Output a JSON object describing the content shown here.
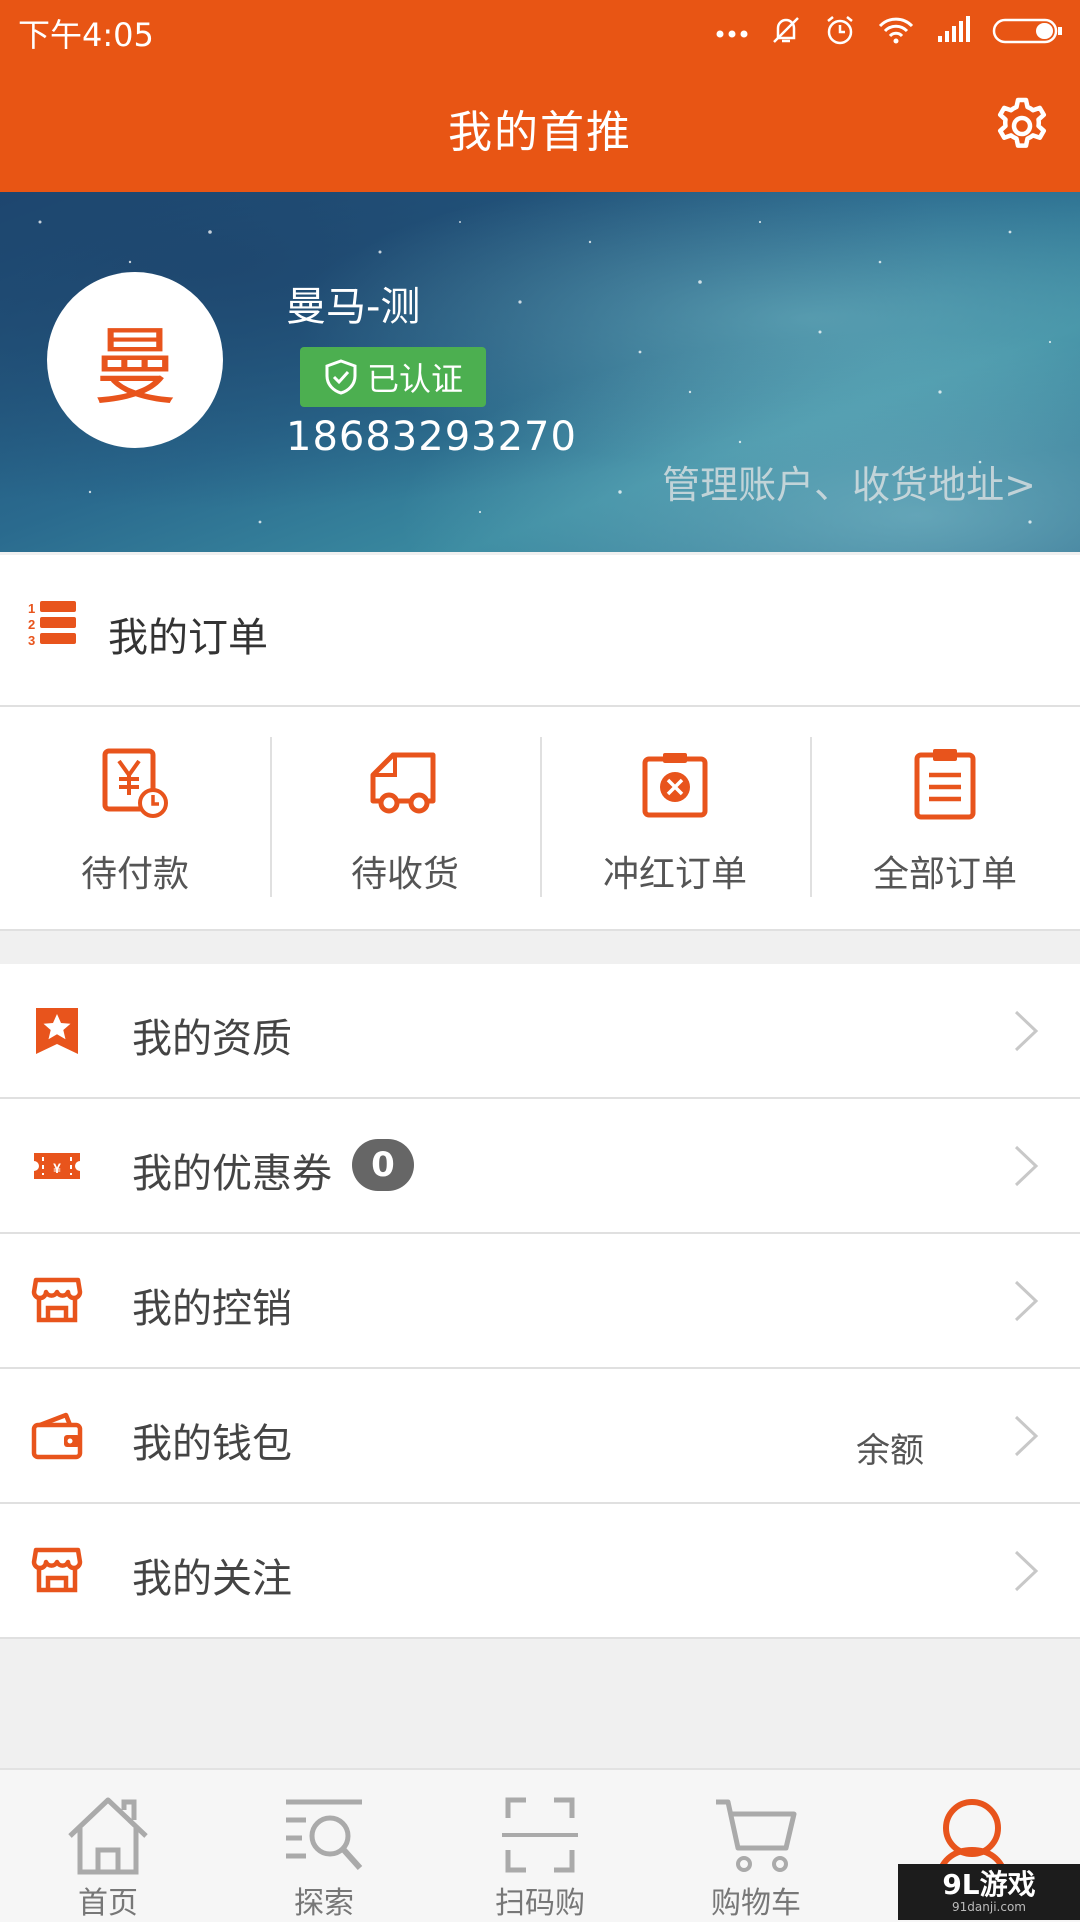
{
  "status_bar": {
    "time": "下午4:05"
  },
  "header": {
    "title": "我的首推"
  },
  "profile": {
    "avatar_char": "曼",
    "name": "曼马-测",
    "verified_label": "已认证",
    "phone": "18683293270",
    "manage_link": "管理账户、收货地址>"
  },
  "orders": {
    "title": "我的订单",
    "items": [
      {
        "label": "待付款",
        "icon": "payment-pending-icon"
      },
      {
        "label": "待收货",
        "icon": "delivery-truck-icon"
      },
      {
        "label": "冲红订单",
        "icon": "cancel-order-icon"
      },
      {
        "label": "全部订单",
        "icon": "clipboard-list-icon"
      }
    ]
  },
  "menu": {
    "items": [
      {
        "label": "我的资质",
        "icon": "star-bookmark-icon"
      },
      {
        "label": "我的优惠券",
        "icon": "coupon-icon",
        "badge": "0"
      },
      {
        "label": "我的控销",
        "icon": "store-icon"
      },
      {
        "label": "我的钱包",
        "icon": "wallet-icon",
        "extra": "余额"
      },
      {
        "label": "我的关注",
        "icon": "store-icon"
      }
    ]
  },
  "tabbar": {
    "items": [
      {
        "label": "首页",
        "icon": "home-icon"
      },
      {
        "label": "探索",
        "icon": "explore-search-icon"
      },
      {
        "label": "扫码购",
        "icon": "scan-icon"
      },
      {
        "label": "购物车",
        "icon": "cart-icon"
      },
      {
        "label": "",
        "icon": "user-icon",
        "active": true
      }
    ]
  },
  "watermark": {
    "line1": "9L游戏",
    "line2": "91danji.com"
  },
  "colors": {
    "brand": "#e85514",
    "verified": "#4caf50",
    "icon": "#e8541c"
  }
}
